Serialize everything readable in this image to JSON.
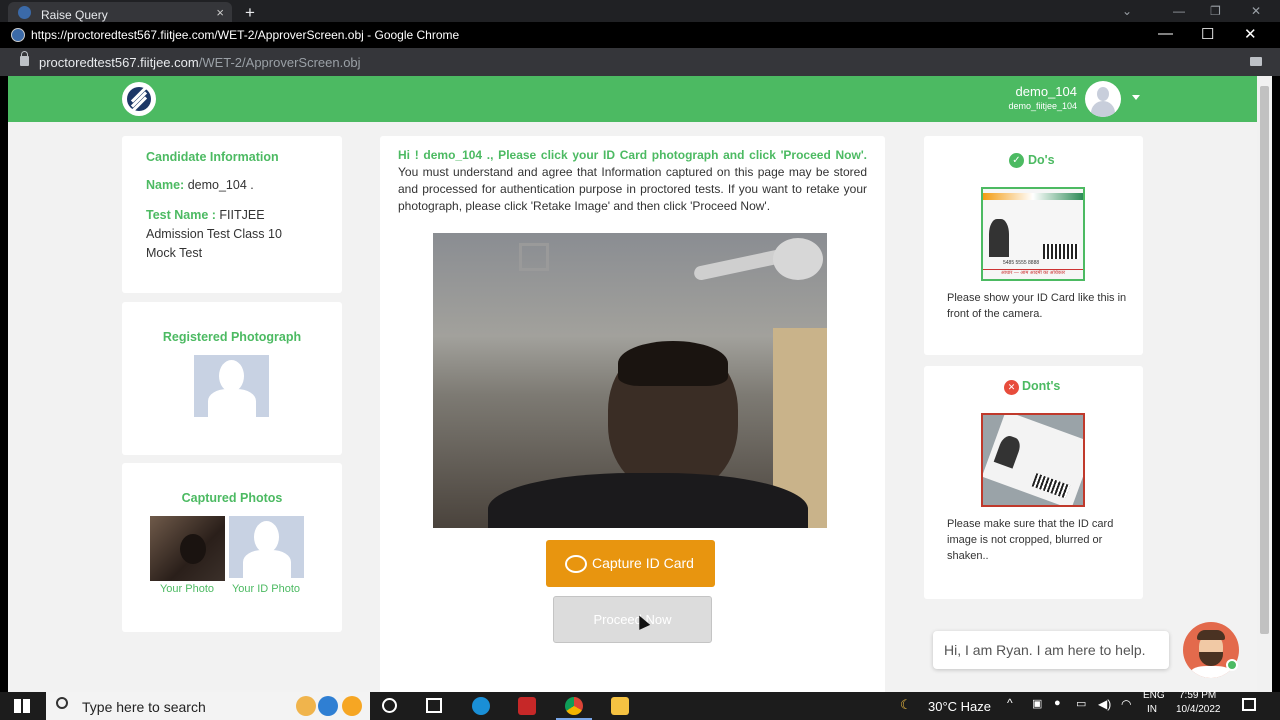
{
  "browser": {
    "tab_title": "Raise Query",
    "tab_close": "×",
    "new_tab": "+",
    "window_title": "https://proctoredtest567.fiitjee.com/WET-2/ApproverScreen.obj - Google Chrome",
    "url_domain": "proctoredtest567.fiitjee.com",
    "url_path": "/WET-2/ApproverScreen.obj",
    "minimize": "—",
    "maximize": "☐",
    "close": "✕"
  },
  "header": {
    "username": "demo_104",
    "subname": "demo_fiitjee_104"
  },
  "candidate": {
    "heading": "Candidate Information",
    "name_label": "Name:",
    "name_value": "demo_104 .",
    "test_label": "Test Name :",
    "test_value_1": "FIITJEE",
    "test_value_2": "Admission Test Class 10",
    "test_value_3": "Mock Test"
  },
  "registered": {
    "heading": "Registered Photograph"
  },
  "captured": {
    "heading": "Captured Photos",
    "your_photo": "Your Photo",
    "your_id_photo": "Your ID Photo"
  },
  "instructions": {
    "greeting": "Hi ! demo_104 ., Please click your ID Card photograph and click 'Proceed Now'.",
    "body": "You must understand and agree that Information captured on this page may be stored and processed for authentication purpose in proctored tests. If you want to retake your photograph, please click 'Retake Image' and then click 'Proceed Now'."
  },
  "buttons": {
    "capture": "Capture ID Card",
    "proceed": "Proceed Now"
  },
  "dos": {
    "heading": "Do's",
    "text": "Please show your ID Card like this in front of the camera.",
    "card_number": "5485 5555 8888",
    "card_footer": "आधार — आम आदमी का अधिकार"
  },
  "donts": {
    "heading": "Dont's",
    "text": "Please make sure that the ID card image is not cropped, blurred or shaken.."
  },
  "chat": {
    "bubble": "Hi, I am Ryan. I am here to help."
  },
  "taskbar": {
    "search_placeholder": "Type here to search",
    "weather": "30°C  Haze",
    "lang_1": "ENG",
    "lang_2": "IN",
    "time": "7:59 PM",
    "date": "10/4/2022"
  },
  "colors": {
    "brand_green": "#4cba62",
    "capture_orange": "#e8950f",
    "proceed_disabled": "#dcdcdc",
    "chrome_dark": "#202124"
  }
}
